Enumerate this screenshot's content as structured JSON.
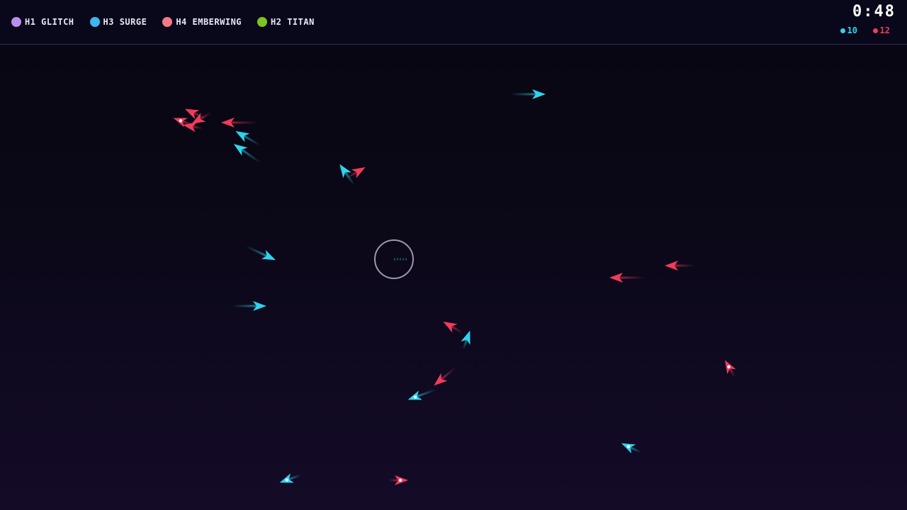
{
  "hud": {
    "heroes": [
      {
        "label": "H1 GLITCH",
        "color": "#b98ef0"
      },
      {
        "label": "H3 SURGE",
        "color": "#3fb6ee"
      },
      {
        "label": "H4 EMBERWING",
        "color": "#f47a86"
      },
      {
        "label": "H2 TITAN",
        "color": "#7cc51e"
      }
    ],
    "timer": "0:48",
    "score_blue": "10",
    "score_red": "12"
  },
  "colors": {
    "blue_team": "#2fd3ee",
    "red_team": "#f23b5c",
    "divider": "#3a2f66"
  }
}
